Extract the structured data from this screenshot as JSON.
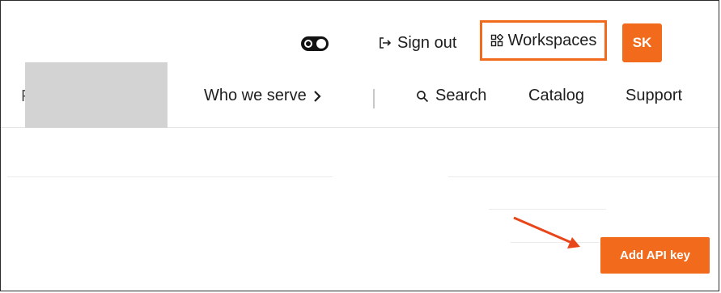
{
  "top_bar": {
    "theme_toggle_icon": "theme-toggle-icon",
    "sign_out_label": "Sign out",
    "sign_out_icon": "sign-out-icon",
    "workspaces_label": "Workspaces",
    "workspaces_icon": "grid-icon",
    "avatar_initials": "SK"
  },
  "nav": {
    "cut_letter": "F",
    "who_we_serve_label": "Who we serve",
    "search_label": "Search",
    "catalog_label": "Catalog",
    "support_label": "Support"
  },
  "main": {
    "add_api_key_label": "Add API key"
  },
  "colors": {
    "accent": "#f26a1b",
    "text": "#1e1e1e",
    "redaction": "#d3d3d3",
    "annotation_arrow": "#e8461a"
  }
}
